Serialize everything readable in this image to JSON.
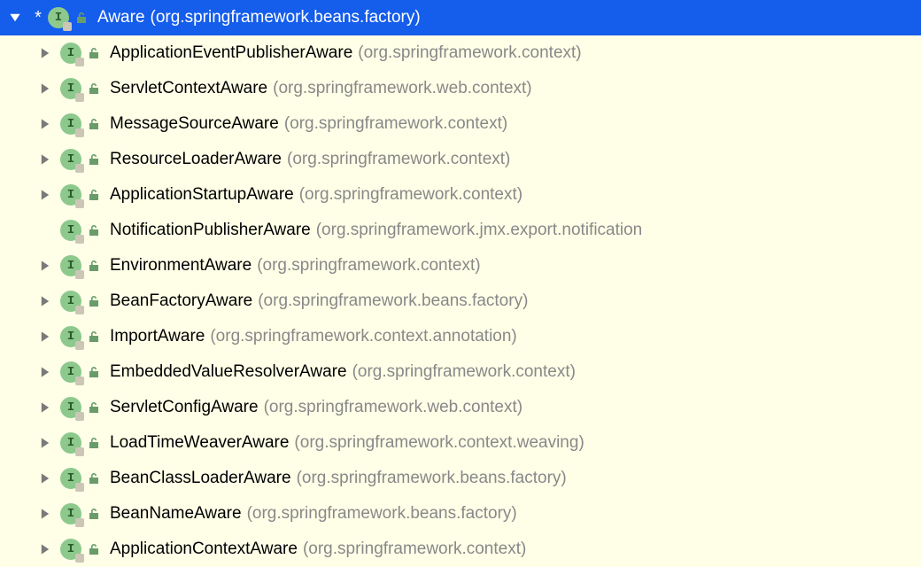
{
  "root": {
    "modified": "*",
    "iconLetter": "I",
    "name": "Aware",
    "package": "(org.springframework.beans.factory)",
    "expanded": true
  },
  "children": [
    {
      "expandable": true,
      "iconLetter": "I",
      "name": "ApplicationEventPublisherAware",
      "package": "(org.springframework.context)"
    },
    {
      "expandable": true,
      "iconLetter": "I",
      "name": "ServletContextAware",
      "package": "(org.springframework.web.context)"
    },
    {
      "expandable": true,
      "iconLetter": "I",
      "name": "MessageSourceAware",
      "package": "(org.springframework.context)"
    },
    {
      "expandable": true,
      "iconLetter": "I",
      "name": "ResourceLoaderAware",
      "package": "(org.springframework.context)"
    },
    {
      "expandable": true,
      "iconLetter": "I",
      "name": "ApplicationStartupAware",
      "package": "(org.springframework.context)"
    },
    {
      "expandable": false,
      "iconLetter": "I",
      "name": "NotificationPublisherAware",
      "package": "(org.springframework.jmx.export.notification"
    },
    {
      "expandable": true,
      "iconLetter": "I",
      "name": "EnvironmentAware",
      "package": "(org.springframework.context)"
    },
    {
      "expandable": true,
      "iconLetter": "I",
      "name": "BeanFactoryAware",
      "package": "(org.springframework.beans.factory)"
    },
    {
      "expandable": true,
      "iconLetter": "I",
      "name": "ImportAware",
      "package": "(org.springframework.context.annotation)"
    },
    {
      "expandable": true,
      "iconLetter": "I",
      "name": "EmbeddedValueResolverAware",
      "package": "(org.springframework.context)"
    },
    {
      "expandable": true,
      "iconLetter": "I",
      "name": "ServletConfigAware",
      "package": "(org.springframework.web.context)"
    },
    {
      "expandable": true,
      "iconLetter": "I",
      "name": "LoadTimeWeaverAware",
      "package": "(org.springframework.context.weaving)"
    },
    {
      "expandable": true,
      "iconLetter": "I",
      "name": "BeanClassLoaderAware",
      "package": "(org.springframework.beans.factory)"
    },
    {
      "expandable": true,
      "iconLetter": "I",
      "name": "BeanNameAware",
      "package": "(org.springframework.beans.factory)"
    },
    {
      "expandable": true,
      "iconLetter": "I",
      "name": "ApplicationContextAware",
      "package": "(org.springframework.context)"
    }
  ]
}
